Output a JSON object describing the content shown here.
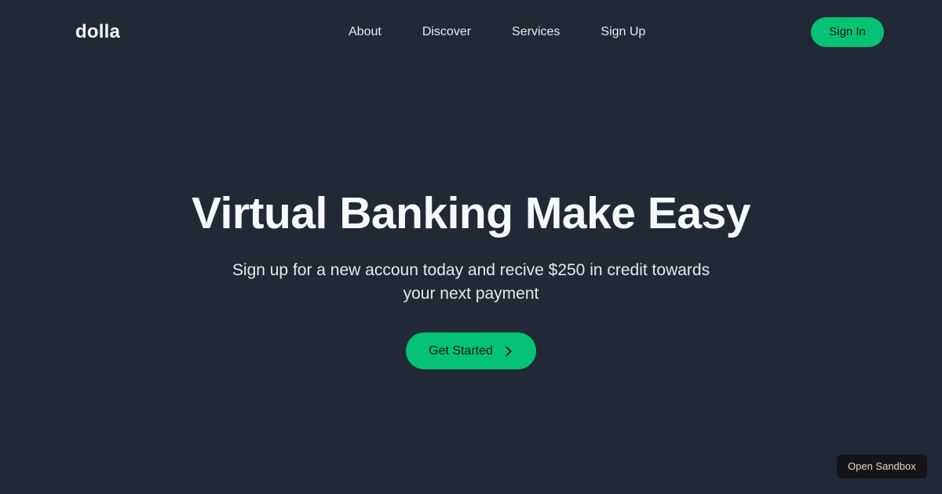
{
  "theme": {
    "background": "#212936",
    "accent": "#05c274",
    "text_primary": "#f7f8fa",
    "text_secondary": "#e6e9ec",
    "badge_background": "#151515"
  },
  "header": {
    "brand": "dolla",
    "nav_items": [
      {
        "label": "About"
      },
      {
        "label": "Discover"
      },
      {
        "label": "Services"
      },
      {
        "label": "Sign Up"
      }
    ],
    "signin_label": "Sign In"
  },
  "hero": {
    "title": "Virtual Banking Make Easy",
    "subtitle": "Sign up for a new accoun today and recive $250 in credit towards your next payment",
    "cta_label": "Get Started",
    "cta_icon": "chevron-right-icon"
  },
  "overlay": {
    "sandbox_label": "Open Sandbox"
  }
}
